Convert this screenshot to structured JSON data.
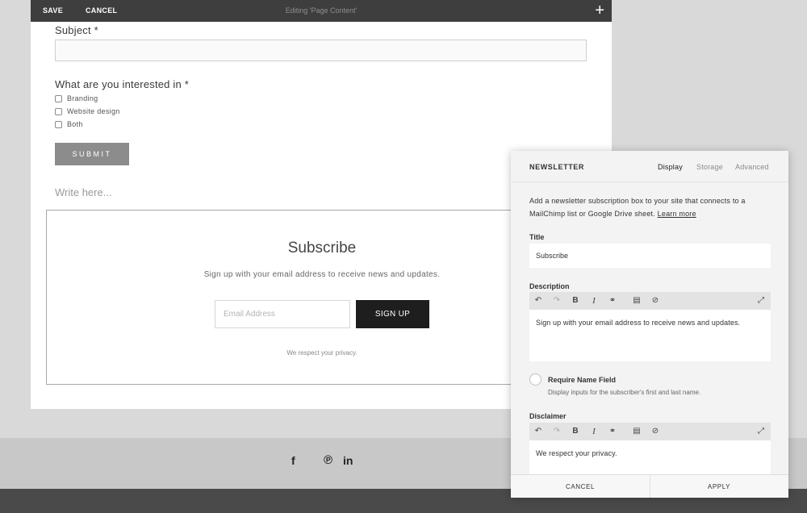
{
  "topbar": {
    "save_label": "SAVE",
    "cancel_label": "CANCEL",
    "editing_label": "Editing 'Page Content'",
    "add_icon": "+"
  },
  "form": {
    "subject_label": "Subject *",
    "interest_label": "What are you interested in *",
    "options": [
      "Branding",
      "Website design",
      "Both"
    ],
    "submit_label": "SUBMIT",
    "write_placeholder": "Write here..."
  },
  "subscribe_block": {
    "title": "Subscribe",
    "description": "Sign up with your email address to receive news and updates.",
    "email_placeholder": "Email Address",
    "button_label": "SIGN UP",
    "privacy": "We respect your privacy."
  },
  "footer": {
    "icons": [
      "facebook-icon",
      "pinterest-icon",
      "linkedin-icon"
    ],
    "facebook_glyph": "f",
    "pinterest_glyph": "℗",
    "linkedin_glyph": "in"
  },
  "panel": {
    "title": "NEWSLETTER",
    "tabs": [
      {
        "label": "Display",
        "active": true
      },
      {
        "label": "Storage",
        "active": false
      },
      {
        "label": "Advanced",
        "active": false
      }
    ],
    "intro": "Add a newsletter subscription box to your site that connects to a MailChimp list or Google Drive sheet.",
    "learn_more": "Learn more",
    "title_label": "Title",
    "title_value": "Subscribe",
    "description_label": "Description",
    "description_value": "Sign up with your email address to receive news and updates.",
    "require_name_label": "Require Name Field",
    "require_name_desc": "Display inputs for the subscriber's first and last name.",
    "disclaimer_label": "Disclaimer",
    "disclaimer_value": "We respect your privacy.",
    "cancel_label": "CANCEL",
    "apply_label": "APPLY",
    "toolbar": {
      "undo": "↶",
      "redo": "↷",
      "bold": "B",
      "italic": "I",
      "link": "⚭",
      "clipboard": "▤",
      "clear": "⊘",
      "expand": "⤢"
    }
  }
}
